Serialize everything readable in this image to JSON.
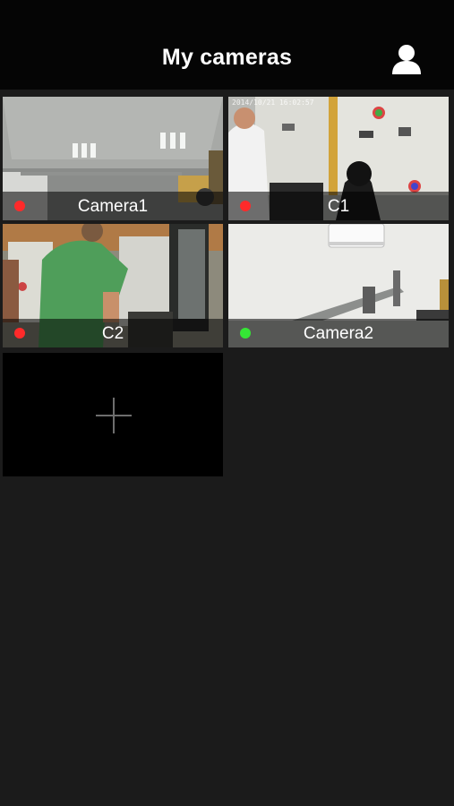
{
  "header": {
    "title": "My cameras",
    "user_icon": "user-icon"
  },
  "cameras": [
    {
      "name": "Camera1",
      "status": "offline",
      "status_color": "#ff2a2a",
      "timestamp": ""
    },
    {
      "name": "C1",
      "status": "offline",
      "status_color": "#ff2a2a",
      "timestamp": "2014/10/21 16:02:57"
    },
    {
      "name": "C2",
      "status": "offline",
      "status_color": "#ff2a2a",
      "timestamp": ""
    },
    {
      "name": "Camera2",
      "status": "online",
      "status_color": "#35e635",
      "timestamp": ""
    }
  ],
  "add_camera": {
    "icon": "plus-icon"
  },
  "colors": {
    "header_bg": "#050505",
    "page_bg": "#1b1b1b",
    "offline": "#ff2a2a",
    "online": "#35e635"
  }
}
